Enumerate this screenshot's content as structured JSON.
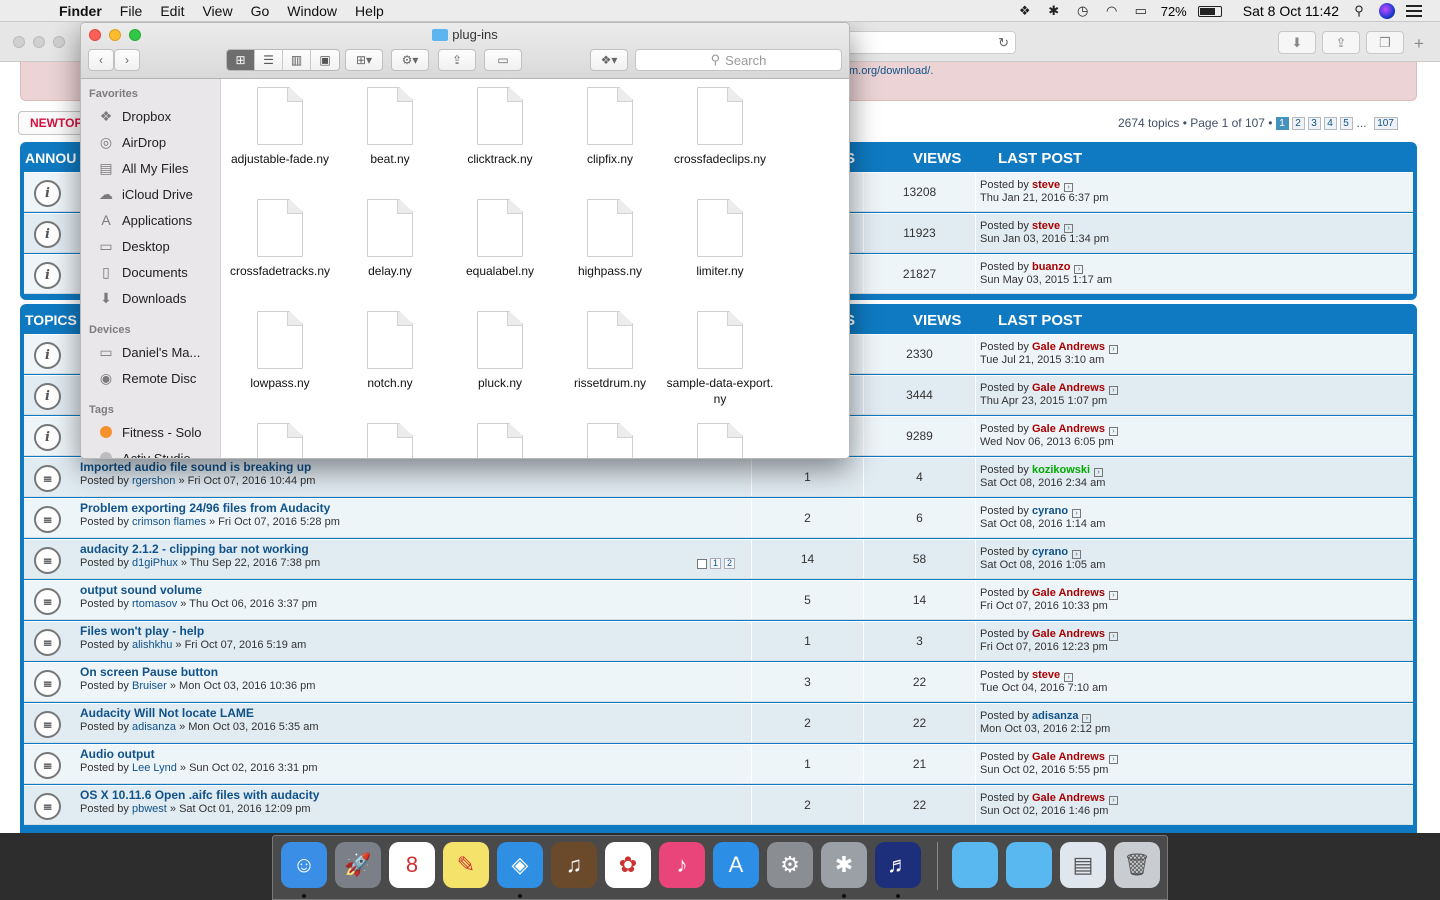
{
  "menubar": {
    "app": "Finder",
    "items": [
      "File",
      "Edit",
      "View",
      "Go",
      "Window",
      "Help"
    ],
    "battery": "72%",
    "datetime": "Sat 8 Oct  11:42"
  },
  "forum": {
    "download_link": "m.org/download/.",
    "new_topic": "NEWTOP",
    "pagination": {
      "summary": "2674 topics • Page 1 of 107 •",
      "pages": [
        "1",
        "2",
        "3",
        "4",
        "5"
      ],
      "ellipsis": "...",
      "last": "107"
    },
    "announcements": {
      "header": "ANNOU",
      "col_stub": "S",
      "col_views": "VIEWS",
      "col_lastpost": "LAST POST",
      "rows": [
        {
          "views": "13208",
          "lp_prefix": "Posted by ",
          "lp_user": "steve",
          "lp_color": "#aa0000",
          "lp_date": "Thu Jan 21, 2016 6:37 pm"
        },
        {
          "views": "11923",
          "lp_prefix": "Posted by ",
          "lp_user": "steve",
          "lp_color": "#aa0000",
          "lp_date": "Sun Jan 03, 2016 1:34 pm"
        },
        {
          "views": "21827",
          "lp_prefix": "Posted by ",
          "lp_user": "buanzo",
          "lp_color": "#aa0000",
          "lp_date": "Sun May 03, 2015 1:17 am"
        }
      ]
    },
    "topics": {
      "header": "TOPICS",
      "col_stub": "S",
      "col_views": "VIEWS",
      "col_lastpost": "LAST POST",
      "sticky_rows": [
        {
          "views": "2330",
          "lp_prefix": "Posted by ",
          "lp_user": "Gale Andrews",
          "lp_color": "#aa0000",
          "lp_date": "Tue Jul 21, 2015 3:10 am"
        },
        {
          "views": "3444",
          "lp_prefix": "Posted by ",
          "lp_user": "Gale Andrews",
          "lp_color": "#aa0000",
          "lp_date": "Thu Apr 23, 2015 1:07 pm"
        },
        {
          "views": "9289",
          "lp_prefix": "Posted by ",
          "lp_user": "Gale Andrews",
          "lp_color": "#aa0000",
          "lp_date": "Wed Nov 06, 2013 6:05 pm"
        }
      ],
      "rows": [
        {
          "title": "Imported audio file sound is breaking up",
          "by_prefix": "Posted by ",
          "author": "rgershon",
          "by_date": " » Fri Oct 07, 2016 10:44 pm",
          "replies": "1",
          "views": "4",
          "lp_prefix": "Posted by ",
          "lp_user": "kozikowski",
          "lp_color": "#00aa00",
          "lp_date": "Sat Oct 08, 2016 2:34 am"
        },
        {
          "title": "Problem exporting 24/96 files from Audacity",
          "by_prefix": "Posted by ",
          "author": "crimson flames",
          "by_date": " » Fri Oct 07, 2016 5:28 pm",
          "replies": "2",
          "views": "6",
          "lp_prefix": "Posted by ",
          "lp_user": "cyrano",
          "lp_color": "#105289",
          "lp_date": "Sat Oct 08, 2016 1:14 am"
        },
        {
          "title": "audacity 2.1.2 - clipping bar not working",
          "by_prefix": "Posted by ",
          "author": "d1giPhux",
          "by_date": " » Thu Sep 22, 2016 7:38 pm",
          "replies": "14",
          "views": "58",
          "lp_prefix": "Posted by ",
          "lp_user": "cyrano",
          "lp_color": "#105289",
          "lp_date": "Sat Oct 08, 2016 1:05 am",
          "minipages": [
            "1",
            "2"
          ]
        },
        {
          "title": "output sound volume",
          "by_prefix": "Posted by ",
          "author": "rtomasov",
          "by_date": " » Thu Oct 06, 2016 3:37 pm",
          "replies": "5",
          "views": "14",
          "lp_prefix": "Posted by ",
          "lp_user": "Gale Andrews",
          "lp_color": "#aa0000",
          "lp_date": "Fri Oct 07, 2016 10:33 pm"
        },
        {
          "title": "Files won't play - help",
          "by_prefix": "Posted by ",
          "author": "alishkhu",
          "by_date": " » Fri Oct 07, 2016 5:19 am",
          "replies": "1",
          "views": "3",
          "lp_prefix": "Posted by ",
          "lp_user": "Gale Andrews",
          "lp_color": "#aa0000",
          "lp_date": "Fri Oct 07, 2016 12:23 pm"
        },
        {
          "title": "On screen Pause button",
          "by_prefix": "Posted by ",
          "author": "Bruiser",
          "by_date": " » Mon Oct 03, 2016 10:36 pm",
          "replies": "3",
          "views": "22",
          "lp_prefix": "Posted by ",
          "lp_user": "steve",
          "lp_color": "#aa0000",
          "lp_date": "Tue Oct 04, 2016 7:10 am"
        },
        {
          "title": "Audacity Will Not locate LAME",
          "by_prefix": "Posted by ",
          "author": "adisanza",
          "by_date": " » Mon Oct 03, 2016 5:35 am",
          "replies": "2",
          "views": "22",
          "lp_prefix": "Posted by ",
          "lp_user": "adisanza",
          "lp_color": "#105289",
          "lp_date": "Mon Oct 03, 2016 2:12 pm"
        },
        {
          "title": "Audio output",
          "by_prefix": "Posted by ",
          "author": "Lee Lynd",
          "by_date": " » Sun Oct 02, 2016 3:31 pm",
          "replies": "1",
          "views": "21",
          "lp_prefix": "Posted by ",
          "lp_user": "Gale Andrews",
          "lp_color": "#aa0000",
          "lp_date": "Sun Oct 02, 2016 5:55 pm"
        },
        {
          "title": "OS X 10.11.6 Open .aifc files with audacity",
          "by_prefix": "Posted by ",
          "author": "pbwest",
          "by_date": " » Sat Oct 01, 2016 12:09 pm",
          "replies": "2",
          "views": "22",
          "lp_prefix": "Posted by ",
          "lp_user": "Gale Andrews",
          "lp_color": "#aa0000",
          "lp_date": "Sun Oct 02, 2016 1:46 pm"
        }
      ]
    }
  },
  "finder": {
    "title": "plug-ins",
    "search_placeholder": "Search",
    "sidebar": {
      "favorites_header": "Favorites",
      "favorites": [
        {
          "label": "Dropbox",
          "icon": "dropbox-icon",
          "glyph": "❖"
        },
        {
          "label": "AirDrop",
          "icon": "airdrop-icon",
          "glyph": "◎"
        },
        {
          "label": "All My Files",
          "icon": "all-files-icon",
          "glyph": "▤"
        },
        {
          "label": "iCloud Drive",
          "icon": "icloud-icon",
          "glyph": "☁"
        },
        {
          "label": "Applications",
          "icon": "applications-icon",
          "glyph": "A"
        },
        {
          "label": "Desktop",
          "icon": "desktop-icon",
          "glyph": "▭"
        },
        {
          "label": "Documents",
          "icon": "documents-icon",
          "glyph": "▯"
        },
        {
          "label": "Downloads",
          "icon": "downloads-icon",
          "glyph": "⬇"
        }
      ],
      "devices_header": "Devices",
      "devices": [
        {
          "label": "Daniel's Ma...",
          "icon": "laptop-icon",
          "glyph": "▭"
        },
        {
          "label": "Remote Disc",
          "icon": "disc-icon",
          "glyph": "◉"
        }
      ],
      "tags_header": "Tags",
      "tags": [
        {
          "label": "Fitness - Solo",
          "color": "#f5922f"
        },
        {
          "label": "Activ Studio",
          "color": "#bdbdbd"
        }
      ]
    },
    "files": [
      "adjustable-fade.ny",
      "beat.ny",
      "clicktrack.ny",
      "clipfix.ny",
      "crossfadeclips.ny",
      "crossfadetracks.ny",
      "delay.ny",
      "equalabel.ny",
      "highpass.ny",
      "limiter.ny",
      "lowpass.ny",
      "notch.ny",
      "pluck.ny",
      "rissetdrum.ny",
      "sample-data-export.ny",
      "",
      "",
      "",
      "",
      ""
    ]
  },
  "dock": {
    "apps": [
      {
        "name": "finder-dock-icon",
        "bg": "#3a8ee6",
        "glyph": "☺",
        "running": true
      },
      {
        "name": "launchpad-dock-icon",
        "bg": "#7a7f88",
        "glyph": "🚀",
        "running": false
      },
      {
        "name": "calendar-dock-icon",
        "bg": "#ffffff",
        "glyph": "8",
        "running": false
      },
      {
        "name": "stickies-dock-icon",
        "bg": "#f5e26b",
        "glyph": "✎",
        "running": false
      },
      {
        "name": "safari-dock-icon",
        "bg": "#2e8fe3",
        "glyph": "◈",
        "running": true
      },
      {
        "name": "garageband-dock-icon",
        "bg": "#6b4a2b",
        "glyph": "♫",
        "running": false
      },
      {
        "name": "photos-dock-icon",
        "bg": "#ffffff",
        "glyph": "✿",
        "running": false
      },
      {
        "name": "itunes-dock-icon",
        "bg": "#e9457a",
        "glyph": "♪",
        "running": false
      },
      {
        "name": "appstore-dock-icon",
        "bg": "#2d8ee6",
        "glyph": "A",
        "running": false
      },
      {
        "name": "system-preferences-dock-icon",
        "bg": "#8a8d92",
        "glyph": "⚙",
        "running": false
      },
      {
        "name": "bug-app-dock-icon",
        "bg": "#9aa0a6",
        "glyph": "✱",
        "running": true
      },
      {
        "name": "audacity-dock-icon",
        "bg": "#1d2e7a",
        "glyph": "♬",
        "running": true
      }
    ],
    "right": [
      {
        "name": "folder-dock-icon",
        "bg": "#59b8f0",
        "glyph": ""
      },
      {
        "name": "downloads-folder-dock-icon",
        "bg": "#59b8f0",
        "glyph": ""
      },
      {
        "name": "document-dock-icon",
        "bg": "#dfe6ee",
        "glyph": "▤"
      },
      {
        "name": "trash-dock-icon",
        "bg": "#c9ccd0",
        "glyph": "🗑"
      }
    ]
  }
}
